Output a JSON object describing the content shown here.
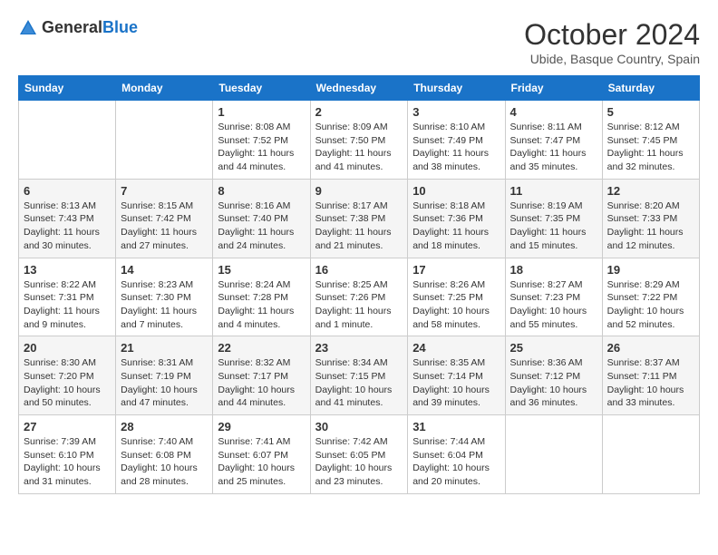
{
  "logo": {
    "general": "General",
    "blue": "Blue"
  },
  "header": {
    "title": "October 2024",
    "subtitle": "Ubide, Basque Country, Spain"
  },
  "weekdays": [
    "Sunday",
    "Monday",
    "Tuesday",
    "Wednesday",
    "Thursday",
    "Friday",
    "Saturday"
  ],
  "weeks": [
    [
      {
        "day": "",
        "info": ""
      },
      {
        "day": "",
        "info": ""
      },
      {
        "day": "1",
        "info": "Sunrise: 8:08 AM\nSunset: 7:52 PM\nDaylight: 11 hours and 44 minutes."
      },
      {
        "day": "2",
        "info": "Sunrise: 8:09 AM\nSunset: 7:50 PM\nDaylight: 11 hours and 41 minutes."
      },
      {
        "day": "3",
        "info": "Sunrise: 8:10 AM\nSunset: 7:49 PM\nDaylight: 11 hours and 38 minutes."
      },
      {
        "day": "4",
        "info": "Sunrise: 8:11 AM\nSunset: 7:47 PM\nDaylight: 11 hours and 35 minutes."
      },
      {
        "day": "5",
        "info": "Sunrise: 8:12 AM\nSunset: 7:45 PM\nDaylight: 11 hours and 32 minutes."
      }
    ],
    [
      {
        "day": "6",
        "info": "Sunrise: 8:13 AM\nSunset: 7:43 PM\nDaylight: 11 hours and 30 minutes."
      },
      {
        "day": "7",
        "info": "Sunrise: 8:15 AM\nSunset: 7:42 PM\nDaylight: 11 hours and 27 minutes."
      },
      {
        "day": "8",
        "info": "Sunrise: 8:16 AM\nSunset: 7:40 PM\nDaylight: 11 hours and 24 minutes."
      },
      {
        "day": "9",
        "info": "Sunrise: 8:17 AM\nSunset: 7:38 PM\nDaylight: 11 hours and 21 minutes."
      },
      {
        "day": "10",
        "info": "Sunrise: 8:18 AM\nSunset: 7:36 PM\nDaylight: 11 hours and 18 minutes."
      },
      {
        "day": "11",
        "info": "Sunrise: 8:19 AM\nSunset: 7:35 PM\nDaylight: 11 hours and 15 minutes."
      },
      {
        "day": "12",
        "info": "Sunrise: 8:20 AM\nSunset: 7:33 PM\nDaylight: 11 hours and 12 minutes."
      }
    ],
    [
      {
        "day": "13",
        "info": "Sunrise: 8:22 AM\nSunset: 7:31 PM\nDaylight: 11 hours and 9 minutes."
      },
      {
        "day": "14",
        "info": "Sunrise: 8:23 AM\nSunset: 7:30 PM\nDaylight: 11 hours and 7 minutes."
      },
      {
        "day": "15",
        "info": "Sunrise: 8:24 AM\nSunset: 7:28 PM\nDaylight: 11 hours and 4 minutes."
      },
      {
        "day": "16",
        "info": "Sunrise: 8:25 AM\nSunset: 7:26 PM\nDaylight: 11 hours and 1 minute."
      },
      {
        "day": "17",
        "info": "Sunrise: 8:26 AM\nSunset: 7:25 PM\nDaylight: 10 hours and 58 minutes."
      },
      {
        "day": "18",
        "info": "Sunrise: 8:27 AM\nSunset: 7:23 PM\nDaylight: 10 hours and 55 minutes."
      },
      {
        "day": "19",
        "info": "Sunrise: 8:29 AM\nSunset: 7:22 PM\nDaylight: 10 hours and 52 minutes."
      }
    ],
    [
      {
        "day": "20",
        "info": "Sunrise: 8:30 AM\nSunset: 7:20 PM\nDaylight: 10 hours and 50 minutes."
      },
      {
        "day": "21",
        "info": "Sunrise: 8:31 AM\nSunset: 7:19 PM\nDaylight: 10 hours and 47 minutes."
      },
      {
        "day": "22",
        "info": "Sunrise: 8:32 AM\nSunset: 7:17 PM\nDaylight: 10 hours and 44 minutes."
      },
      {
        "day": "23",
        "info": "Sunrise: 8:34 AM\nSunset: 7:15 PM\nDaylight: 10 hours and 41 minutes."
      },
      {
        "day": "24",
        "info": "Sunrise: 8:35 AM\nSunset: 7:14 PM\nDaylight: 10 hours and 39 minutes."
      },
      {
        "day": "25",
        "info": "Sunrise: 8:36 AM\nSunset: 7:12 PM\nDaylight: 10 hours and 36 minutes."
      },
      {
        "day": "26",
        "info": "Sunrise: 8:37 AM\nSunset: 7:11 PM\nDaylight: 10 hours and 33 minutes."
      }
    ],
    [
      {
        "day": "27",
        "info": "Sunrise: 7:39 AM\nSunset: 6:10 PM\nDaylight: 10 hours and 31 minutes."
      },
      {
        "day": "28",
        "info": "Sunrise: 7:40 AM\nSunset: 6:08 PM\nDaylight: 10 hours and 28 minutes."
      },
      {
        "day": "29",
        "info": "Sunrise: 7:41 AM\nSunset: 6:07 PM\nDaylight: 10 hours and 25 minutes."
      },
      {
        "day": "30",
        "info": "Sunrise: 7:42 AM\nSunset: 6:05 PM\nDaylight: 10 hours and 23 minutes."
      },
      {
        "day": "31",
        "info": "Sunrise: 7:44 AM\nSunset: 6:04 PM\nDaylight: 10 hours and 20 minutes."
      },
      {
        "day": "",
        "info": ""
      },
      {
        "day": "",
        "info": ""
      }
    ]
  ]
}
